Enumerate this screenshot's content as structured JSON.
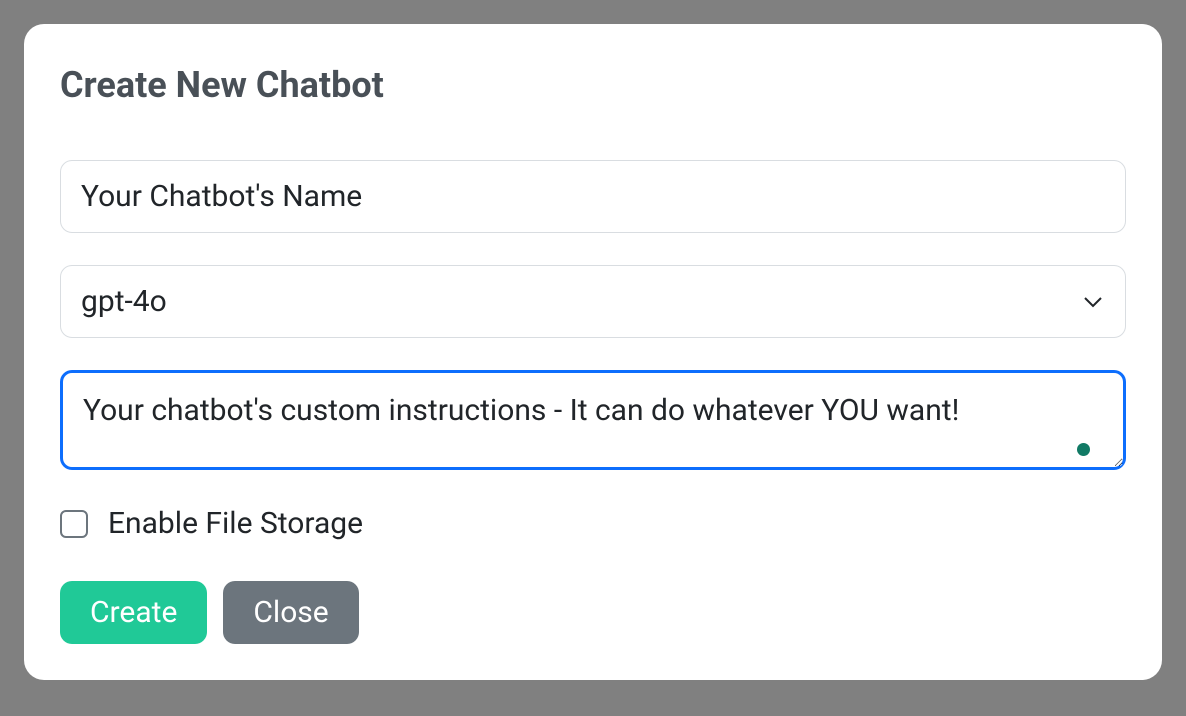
{
  "modal": {
    "title": "Create New Chatbot",
    "name_placeholder": "Your Chatbot's Name",
    "name_value": "",
    "model_selected": "gpt-4o",
    "instructions_placeholder": "Your chatbot's custom instructions - It can do whatever YOU want!",
    "instructions_value": "",
    "file_storage_label": "Enable File Storage",
    "file_storage_checked": false,
    "create_label": "Create",
    "close_label": "Close"
  },
  "colors": {
    "focus_border": "#0d6efd",
    "primary_button": "#20c997",
    "secondary_button": "#6c757d",
    "status_dot": "#117a65"
  }
}
